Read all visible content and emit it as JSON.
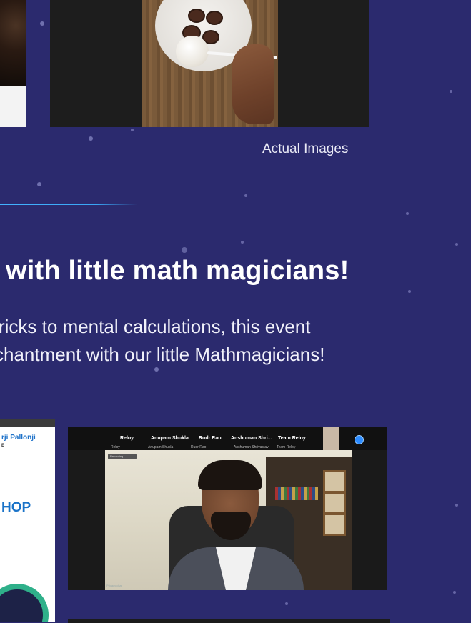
{
  "captions": {
    "actual_images": "Actual Images"
  },
  "section": {
    "heading": "with little math magicians!",
    "paragraph_line1": "ricks to mental calculations, this event",
    "paragraph_line2": "chantment with our little Mathmagicians!"
  },
  "poster": {
    "brand": "rji Pallonji",
    "brand_sub": "E",
    "headline": "HOP"
  },
  "meeting": {
    "participants": [
      {
        "name": "Reloy",
        "sub": "Reloy"
      },
      {
        "name": "Anupam Shukla",
        "sub": "Anupam Shukla"
      },
      {
        "name": "Rudr Rao",
        "sub": "Rudr Rao"
      },
      {
        "name": "Anshuman Shri...",
        "sub": "Anshuman Shrivastav"
      },
      {
        "name": "Team Reloy",
        "sub": "Team Reloy"
      }
    ],
    "recording_label": "Recording...",
    "privacy_label": "Privacy chat"
  },
  "colors": {
    "background": "#2b2a6e",
    "divider": "#43b3ff",
    "poster_accent": "#1a73c8"
  }
}
